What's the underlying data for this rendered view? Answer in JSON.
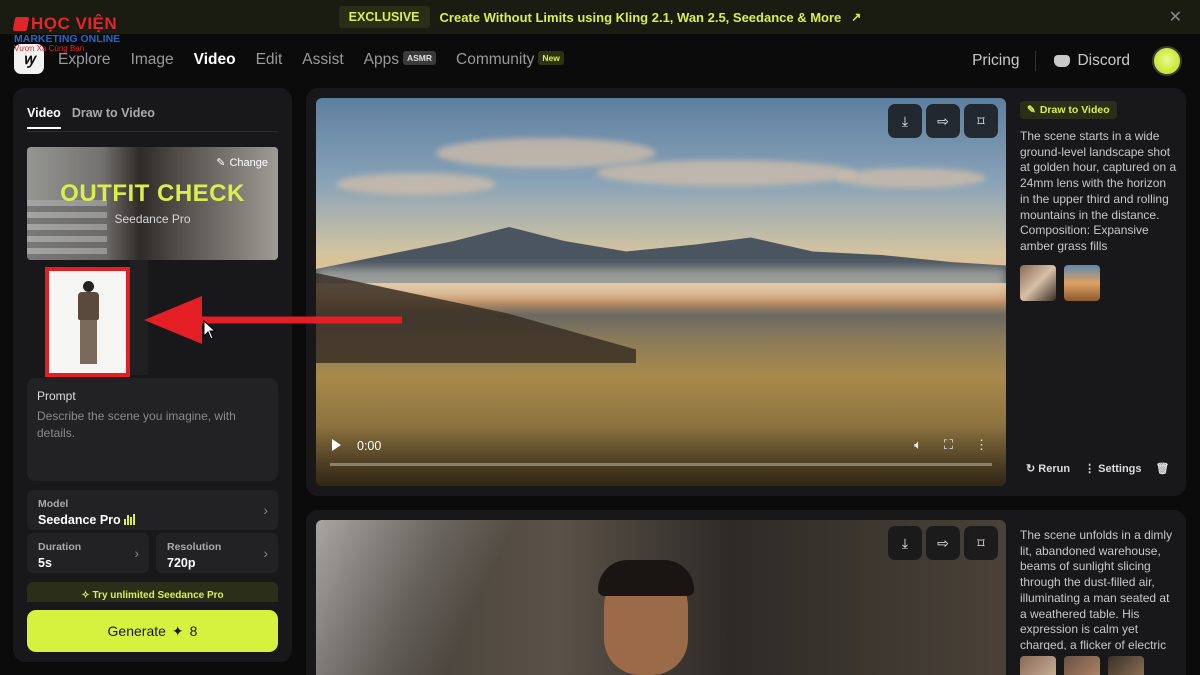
{
  "banner": {
    "pill": "EXCLUSIVE",
    "message": "Create Without Limits using Kling 2.1, Wan 2.5, Seedance & More",
    "arrow": "↗",
    "close": "✕"
  },
  "watermark": {
    "line1": "HỌC VIỆN",
    "line2": "MARKETING ONLINE",
    "line3": "Vươn Xa Cùng Bạn"
  },
  "nav": {
    "logo": "ꝡ",
    "links": [
      "Explore",
      "Image",
      "Video",
      "Edit",
      "Assist",
      "Apps",
      "Community"
    ],
    "active": "Video",
    "apps_badge": "ASMR",
    "community_badge": "New",
    "pricing": "Pricing",
    "discord": "Discord"
  },
  "left": {
    "tabs": [
      "Video",
      "Draw to Video"
    ],
    "thumb_title": "OUTFIT CHECK",
    "thumb_sub": "Seedance Pro",
    "change": "Change",
    "prompt_label": "Prompt",
    "prompt_placeholder": "Describe the scene you imagine, with details.",
    "model_label": "Model",
    "model_value": "Seedance Pro",
    "duration_label": "Duration",
    "duration_value": "5s",
    "resolution_label": "Resolution",
    "resolution_value": "720p",
    "promo": "Try unlimited Seedance Pro",
    "generate_label": "Generate",
    "generate_cost": "8"
  },
  "results": [
    {
      "tag": "Draw to Video",
      "time": "0:00",
      "description": "The scene starts in a wide ground-level landscape shot at golden hour, captured on a 24mm lens with the horizon in the upper third and rolling mountains in the distance. Composition: Expansive amber grass fills",
      "rerun": "Rerun",
      "settings": "Settings"
    },
    {
      "description": "The scene unfolds in a dimly lit, abandoned warehouse, beams of sunlight slicing through the dust-filled air, illuminating a man seated at a weathered table. His expression is calm yet charged, a flicker of electric"
    }
  ],
  "colors": {
    "accent": "#d6f23f",
    "annotation": "#e41e25",
    "panel": "#18181a"
  }
}
